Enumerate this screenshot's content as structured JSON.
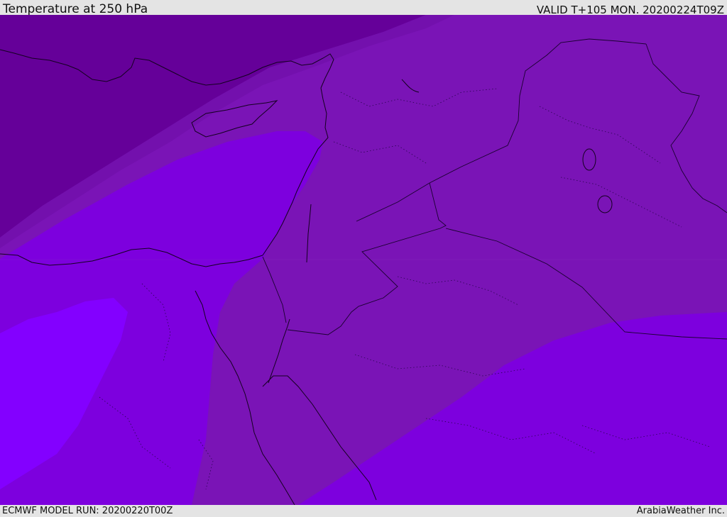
{
  "header": {
    "title": "Temperature at 250 hPa",
    "valid": "VALID T+105 MON. 20200224T09Z"
  },
  "footer": {
    "model_run": "ECMWF MODEL RUN: 20200220T00Z",
    "credit": "ArabiaWeather Inc."
  },
  "colors": {
    "band_coldest": "#650099",
    "band_cold": "#7c16b8",
    "band_mid": "#7b12b8",
    "band_warm": "#7d00de",
    "band_warmest": "#8300ff",
    "coastline": "#140020",
    "border": "#1a0030"
  }
}
